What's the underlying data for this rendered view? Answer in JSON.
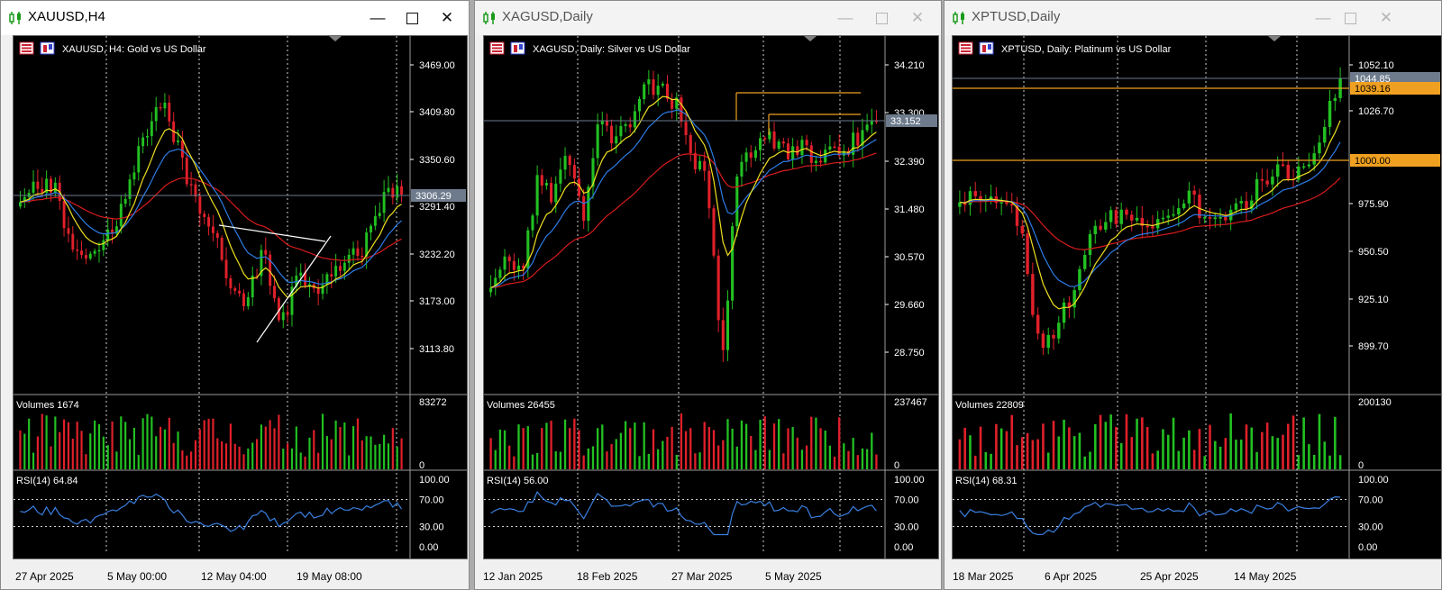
{
  "windows": [
    {
      "title": "XAUUSD,H4",
      "active": true,
      "chart_label": "XAUUSD, H4:  Gold vs US Dollar",
      "price_ticks": [
        "3469.00",
        "3409.80",
        "3350.60",
        "3291.40",
        "3232.20",
        "3173.00",
        "3113.80"
      ],
      "current_price": "3306.29",
      "volume_label": "Volumes 1674",
      "volume_max": "83272",
      "volume_min": "0",
      "rsi_label": "RSI(14) 64.84",
      "rsi_ticks": [
        "100.00",
        "70.00",
        "30.00",
        "0.00"
      ],
      "time_labels": [
        "27 Apr 2025",
        "5 May 00:00",
        "12 May 04:00",
        "19 May 08:00"
      ]
    },
    {
      "title": "XAGUSD,Daily",
      "active": false,
      "chart_label": "XAGUSD, Daily:  Silver vs US Dollar",
      "price_ticks": [
        "34.210",
        "33.300",
        "32.390",
        "31.480",
        "30.570",
        "29.660",
        "28.750"
      ],
      "current_price": "33.152",
      "volume_label": "Volumes 26455",
      "volume_max": "237467",
      "volume_min": "0",
      "rsi_label": "RSI(14) 56.00",
      "rsi_ticks": [
        "100.00",
        "70.00",
        "30.00",
        "0.00"
      ],
      "time_labels": [
        "12 Jan 2025",
        "18 Feb 2025",
        "27 Mar 2025",
        "5 May 2025"
      ]
    },
    {
      "title": "XPTUSD,Daily",
      "active": false,
      "chart_label": "XPTUSD, Daily:  Platinum vs US Dollar",
      "price_ticks": [
        "1052.10",
        "1026.70",
        "975.90",
        "950.50",
        "925.10",
        "899.70"
      ],
      "current_price": "1044.85",
      "level_orange": "1039.16",
      "level_round": "1000.00",
      "volume_label": "Volumes 22809",
      "volume_max": "200130",
      "volume_min": "0",
      "rsi_label": "RSI(14) 68.31",
      "rsi_ticks": [
        "100.00",
        "70.00",
        "30.00",
        "0.00"
      ],
      "time_labels": [
        "18 Mar 2025",
        "6 Apr 2025",
        "25 Apr 2025",
        "14 May 2025"
      ]
    }
  ],
  "colors": {
    "bull": "#22c022",
    "bear": "#e0202a",
    "ma_fast": "#f0e020",
    "ma_mid": "#2c7be5",
    "ma_slow": "#d91c1c",
    "rsi": "#3a7fe0",
    "level": "#f0a020",
    "bid_line": "#6b7a8f"
  },
  "icons": {
    "title_icon": "candlestick-icon",
    "chart_icon": "chart-flags-icon"
  }
}
